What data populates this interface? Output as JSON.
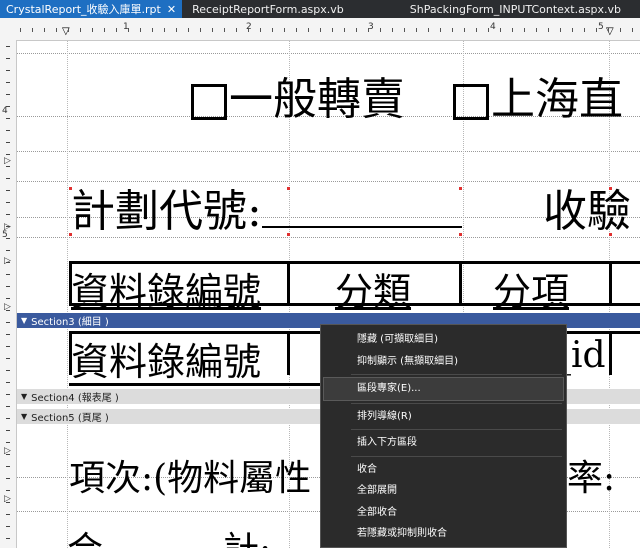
{
  "tabs": [
    {
      "label": "CrystalReport_收驗入庫單.rpt",
      "active": true
    },
    {
      "label": "ReceiptReportForm.aspx.vb",
      "active": false
    },
    {
      "label": "ShPackingForm_INPUTContext.aspx.vb",
      "active": false
    }
  ],
  "ruler": {
    "numbers": [
      "1",
      "2",
      "3",
      "4",
      "5"
    ],
    "vertical_marks": [
      "4",
      "5"
    ]
  },
  "report": {
    "header_option1": "一般轉賣",
    "header_option2": "上海直",
    "plan_code_label": "計劃代號:",
    "receipt_label": "收驗",
    "col_record_no": "資料錄編號",
    "col_category": "分類",
    "col_item": "分項",
    "detail_record_no": "資料錄編號",
    "detail_id": "_id",
    "footer_item_label": "項次:(物料屬性",
    "footer_trail": "率:",
    "footer_bottom1": "合",
    "footer_bottom2": "計:"
  },
  "sections": {
    "section3": "Section3 (細目 )",
    "section4": "Section4 (報表尾 )",
    "section5": "Section5 (頁尾 )"
  },
  "context_menu": {
    "items": [
      "隱藏 (可擷取細目)",
      "抑制顯示 (無擷取細目)",
      "區段專家(E)...",
      "排列導線(R)",
      "插入下方區段",
      "收合",
      "全部展開",
      "全部收合",
      "若隱藏或抑制則收合"
    ]
  }
}
